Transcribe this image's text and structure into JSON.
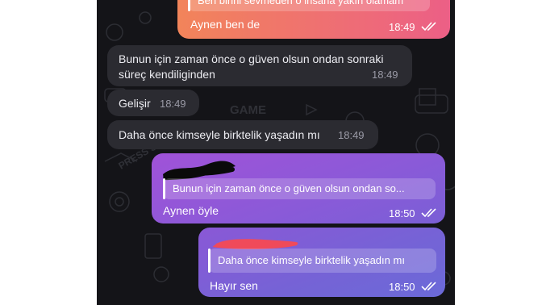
{
  "messages": [
    {
      "id": "m1",
      "direction": "out",
      "quote_text": "Ben birini sevmeden o insana yakın olamam",
      "text": "Aynen ben de",
      "time": "18:49",
      "status_icon": "double-check-icon"
    },
    {
      "id": "m2",
      "direction": "in",
      "text_line1": "Bunun için zaman önce o güven olsun ondan sonraki",
      "text_line2": "süreç kendiliginden",
      "time": "18:49"
    },
    {
      "id": "m3",
      "direction": "in",
      "text": "Gelişir",
      "time": "18:49"
    },
    {
      "id": "m4",
      "direction": "in",
      "text": "Daha önce kimseyle birktelik yaşadın mı",
      "time": "18:49"
    },
    {
      "id": "m5",
      "direction": "out",
      "quote_text": "Bunun için zaman önce o güven olsun ondan so...",
      "text": "Aynen öyle",
      "time": "18:50",
      "status_icon": "double-check-icon"
    },
    {
      "id": "m6",
      "direction": "out",
      "quote_text": "Daha önce kimseyle birktelik yaşadın mı",
      "text": "Hayır sen",
      "time": "18:50",
      "status_icon": "double-check-icon"
    }
  ],
  "background_doodle_text": [
    "GAME",
    "PRESS START"
  ],
  "colors": {
    "chat_background": "#141418",
    "incoming_bubble": "#2b2b31",
    "outgoing_gradient_top": "#ef7b5d",
    "outgoing_gradient_purple": "#a356d6",
    "outgoing_gradient_blue": "#6f6ad8",
    "redaction_black": "#0a0a0a",
    "redaction_red": "#f04a5a"
  }
}
